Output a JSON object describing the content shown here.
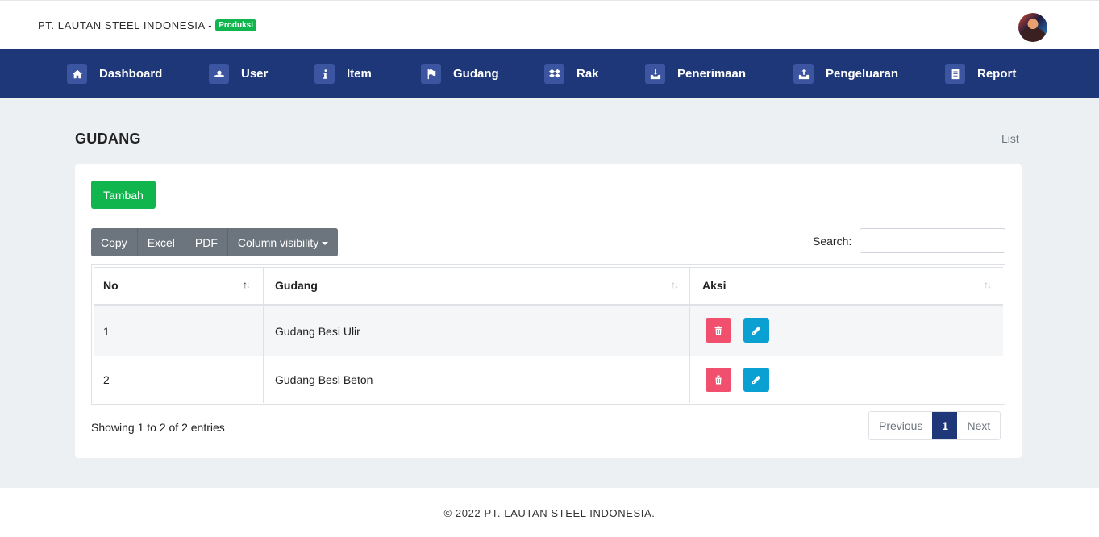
{
  "header": {
    "company": "PT. LAUTAN STEEL INDONESIA -",
    "badge": "Produksi",
    "avatar_icon": "user-avatar"
  },
  "nav": {
    "items": [
      {
        "label": "Dashboard",
        "icon": "home-icon"
      },
      {
        "label": "User",
        "icon": "user-icon"
      },
      {
        "label": "Item",
        "icon": "info-icon"
      },
      {
        "label": "Gudang",
        "icon": "flag-icon"
      },
      {
        "label": "Rak",
        "icon": "dropbox-icon"
      },
      {
        "label": "Penerimaan",
        "icon": "inbox-icon"
      },
      {
        "label": "Pengeluaran",
        "icon": "outbox-icon"
      },
      {
        "label": "Report",
        "icon": "report-icon"
      }
    ]
  },
  "page": {
    "title": "GUDANG",
    "breadcrumb": "List"
  },
  "toolbar": {
    "add_label": "Tambah",
    "export_buttons": [
      "Copy",
      "Excel",
      "PDF",
      "Column visibility"
    ],
    "search_label": "Search:",
    "search_value": ""
  },
  "table": {
    "columns": [
      "No",
      "Gudang",
      "Aksi"
    ],
    "rows": [
      {
        "no": "1",
        "gudang": "Gudang Besi Ulir"
      },
      {
        "no": "2",
        "gudang": "Gudang Besi Beton"
      }
    ]
  },
  "pagination": {
    "info": "Showing 1 to 2 of 2 entries",
    "previous": "Previous",
    "current": "1",
    "next": "Next"
  },
  "footer": {
    "text": "© 2022 PT. LAUTAN STEEL INDONESIA."
  },
  "colors": {
    "navbar": "#1e3779",
    "success": "#10b64d",
    "danger": "#f0506e",
    "info": "#0aa0d2",
    "secondary": "#6c757d"
  }
}
